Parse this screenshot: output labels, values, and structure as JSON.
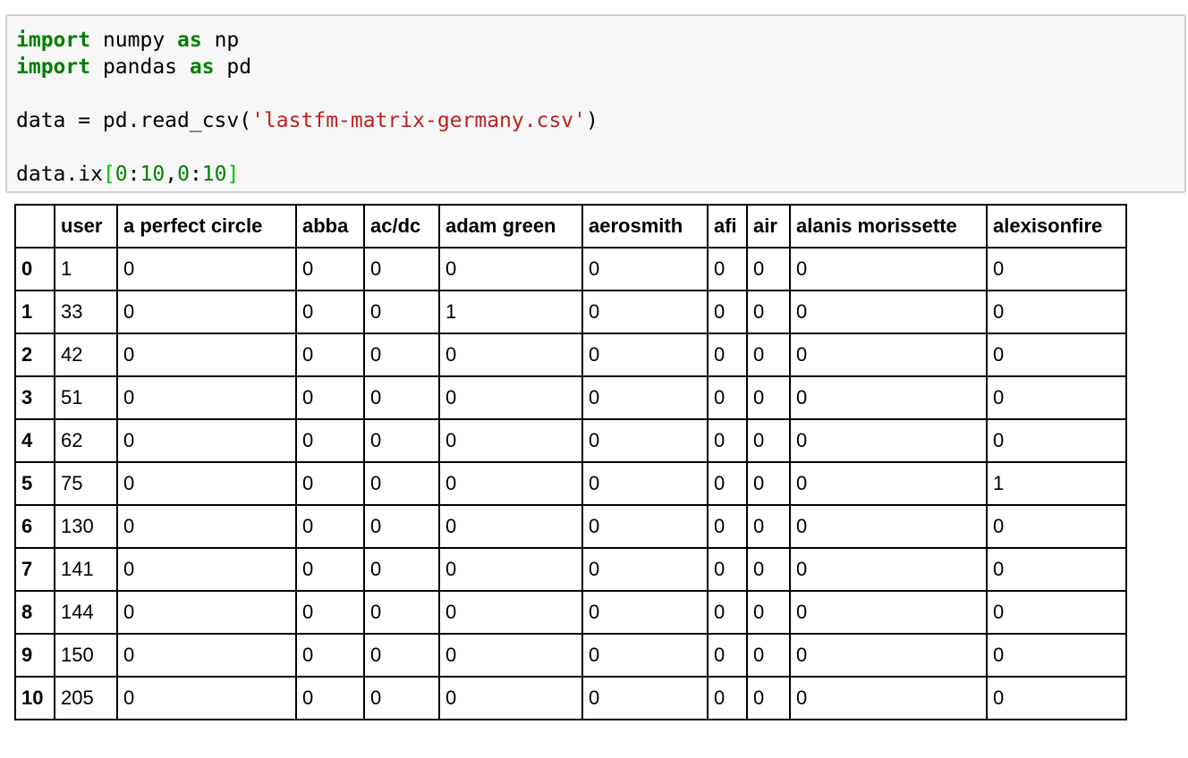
{
  "code_cell": {
    "lines": [
      {
        "kw1": "import",
        "t1": " numpy ",
        "kw2": "as",
        "t2": " np"
      },
      {
        "kw1": "import",
        "t1": " pandas ",
        "kw2": "as",
        "t2": " pd"
      },
      {
        "blank": true
      },
      {
        "t1": "data = pd.read_csv(",
        "str": "'lastfm-matrix-germany.csv'",
        "t2": ")"
      },
      {
        "blank": true
      },
      {
        "t1": "data.ix",
        "b1": "[",
        "n1": "0",
        "t2": ":",
        "n2": "10",
        "t3": ",",
        "n3": "0",
        "t4": ":",
        "n4": "10",
        "b2": "]"
      }
    ]
  },
  "table": {
    "columns": [
      "",
      "user",
      "a perfect circle",
      "abba",
      "ac/dc",
      "adam green",
      "aerosmith",
      "afi",
      "air",
      "alanis morissette",
      "alexisonfire"
    ],
    "rows": [
      {
        "index": "0",
        "cells": [
          "1",
          "0",
          "0",
          "0",
          "0",
          "0",
          "0",
          "0",
          "0",
          "0"
        ]
      },
      {
        "index": "1",
        "cells": [
          "33",
          "0",
          "0",
          "0",
          "1",
          "0",
          "0",
          "0",
          "0",
          "0"
        ]
      },
      {
        "index": "2",
        "cells": [
          "42",
          "0",
          "0",
          "0",
          "0",
          "0",
          "0",
          "0",
          "0",
          "0"
        ]
      },
      {
        "index": "3",
        "cells": [
          "51",
          "0",
          "0",
          "0",
          "0",
          "0",
          "0",
          "0",
          "0",
          "0"
        ]
      },
      {
        "index": "4",
        "cells": [
          "62",
          "0",
          "0",
          "0",
          "0",
          "0",
          "0",
          "0",
          "0",
          "0"
        ]
      },
      {
        "index": "5",
        "cells": [
          "75",
          "0",
          "0",
          "0",
          "0",
          "0",
          "0",
          "0",
          "0",
          "1"
        ]
      },
      {
        "index": "6",
        "cells": [
          "130",
          "0",
          "0",
          "0",
          "0",
          "0",
          "0",
          "0",
          "0",
          "0"
        ]
      },
      {
        "index": "7",
        "cells": [
          "141",
          "0",
          "0",
          "0",
          "0",
          "0",
          "0",
          "0",
          "0",
          "0"
        ]
      },
      {
        "index": "8",
        "cells": [
          "144",
          "0",
          "0",
          "0",
          "0",
          "0",
          "0",
          "0",
          "0",
          "0"
        ]
      },
      {
        "index": "9",
        "cells": [
          "150",
          "0",
          "0",
          "0",
          "0",
          "0",
          "0",
          "0",
          "0",
          "0"
        ]
      },
      {
        "index": "10",
        "cells": [
          "205",
          "0",
          "0",
          "0",
          "0",
          "0",
          "0",
          "0",
          "0",
          "0"
        ]
      }
    ]
  },
  "colors": {
    "keyword": "#008000",
    "string": "#ba2121",
    "number": "#008000",
    "bracket": "#00c000",
    "cell_background": "#f7f7f7",
    "cell_border": "#cfcfcf"
  }
}
